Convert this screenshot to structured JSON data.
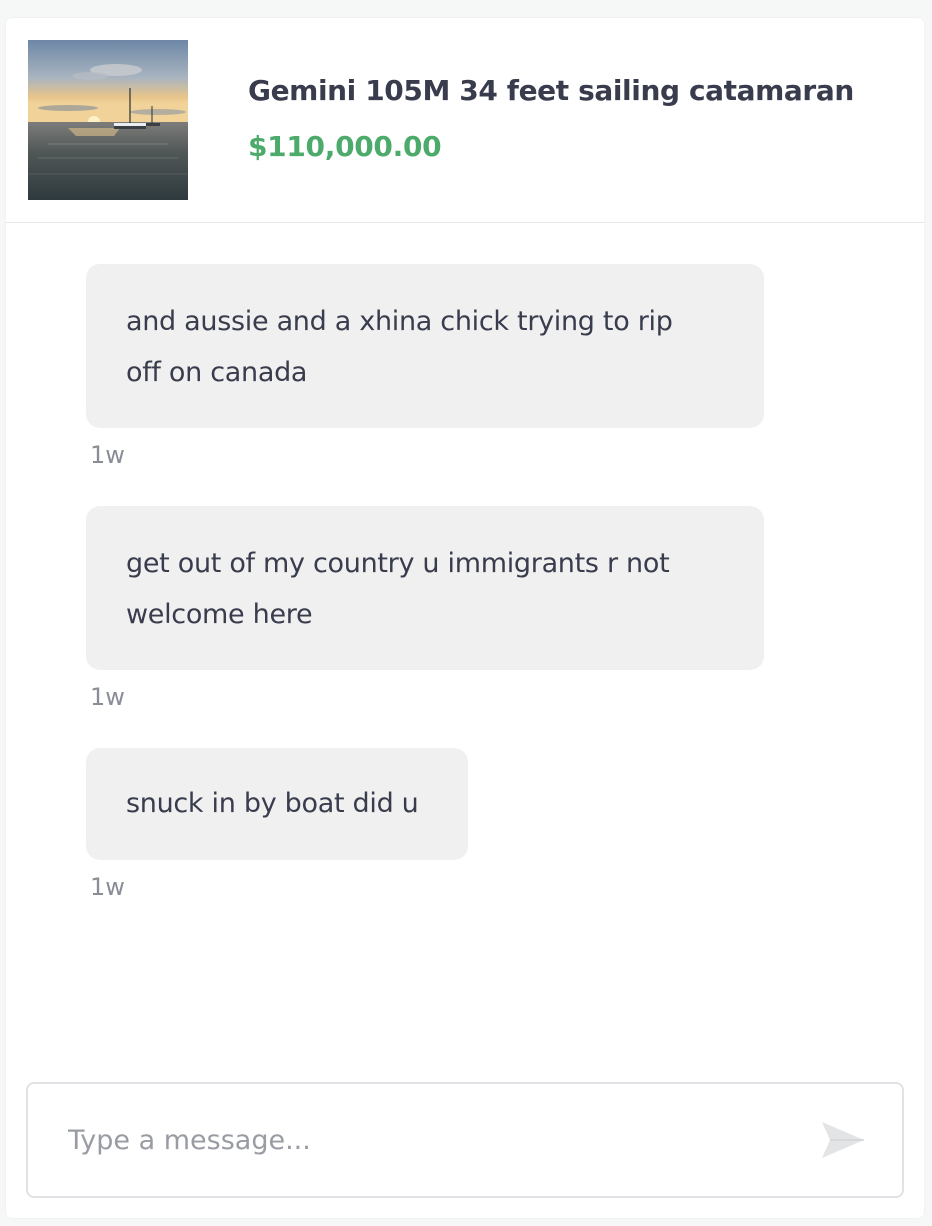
{
  "listing": {
    "image_icon": "catamaran-sunset-photo",
    "title": "Gemini 105M 34 feet sailing catamaran",
    "price": "$110,000.00",
    "price_color": "#4caa6a"
  },
  "messages": [
    {
      "lines": [
        "and aussie and a xhina chick trying to rip",
        "off on canada"
      ],
      "time": "1w"
    },
    {
      "lines": [
        "get out of my country u immigrants r not",
        "welcome here"
      ],
      "time": "1w"
    },
    {
      "lines": [
        "snuck in by boat did u"
      ],
      "time": "1w"
    }
  ],
  "composer": {
    "placeholder": "Type a message...",
    "value": "",
    "send_icon": "send-icon"
  }
}
